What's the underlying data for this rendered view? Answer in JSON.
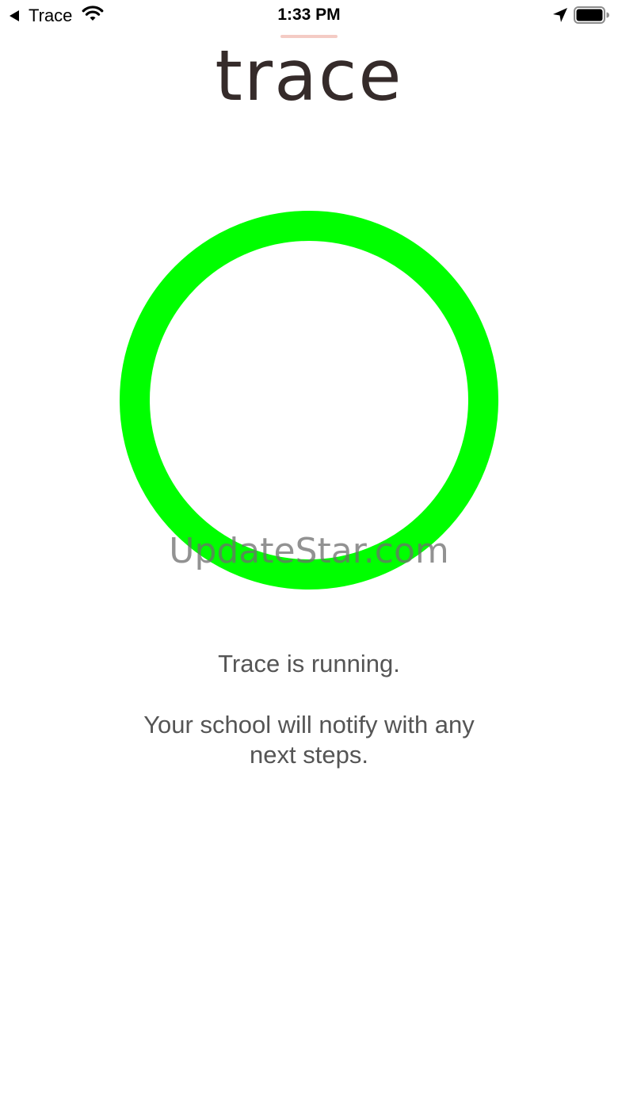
{
  "status_bar": {
    "back_label": "Trace",
    "time": "1:33 PM",
    "icons": [
      "back-arrow-icon",
      "wifi-icon",
      "location-arrow-icon",
      "battery-icon"
    ]
  },
  "header": {
    "logo_text": "trace",
    "logo_color": "#352b2a",
    "underline_color": "#f4cbc4"
  },
  "status_indicator": {
    "ring_color": "#00ff00",
    "state": "running"
  },
  "watermark": {
    "text": "UpdateStar.com"
  },
  "messages": {
    "status": "Trace is running.",
    "next_steps": "Your school will notify with any next steps."
  }
}
